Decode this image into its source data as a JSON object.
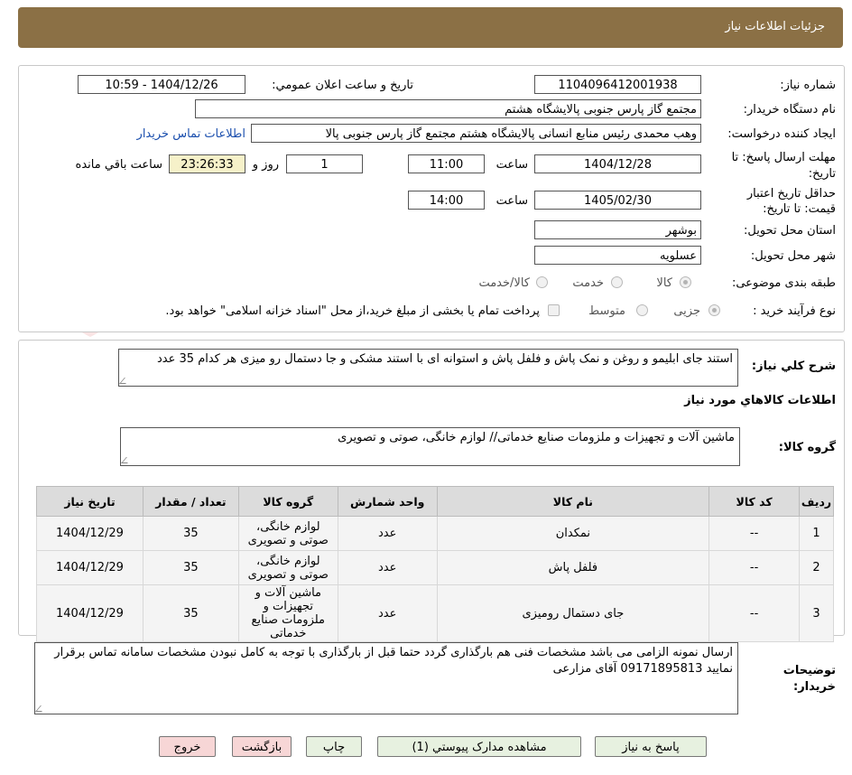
{
  "header": {
    "title": "جزئیات اطلاعات نیاز"
  },
  "form": {
    "need_number_label": "شماره نیاز:",
    "need_number": "1104096412001938",
    "announce_label": "تاریخ و ساعت اعلان عمومي:",
    "announce_value": "1404/12/26 - 10:59",
    "buyer_org_label": "نام دستگاه خریدار:",
    "buyer_org": "مجتمع گاز پارس جنوبی  پالایشگاه هشتم",
    "requester_label": "ایجاد کننده درخواست:",
    "requester": "وهب محمدی رئیس منابع انسانی پالایشگاه هشتم مجتمع گاز پارس جنوبی  پالا",
    "contact_link": "اطلاعات تماس خریدار",
    "deadline_label_1": "مهلت ارسال پاسخ: تا",
    "deadline_label_2": "تاریخ:",
    "deadline_date": "1404/12/28",
    "time_label": "ساعت",
    "deadline_time": "11:00",
    "days_value": "1",
    "days_label": "روز و",
    "remaining_time": "23:26:33",
    "remaining_label": "ساعت باقي مانده",
    "validity_label_1": "حداقل تاريخ اعتبار",
    "validity_label_2": "قيمت: تا تاريخ:",
    "validity_date": "1405/02/30",
    "validity_time": "14:00",
    "province_label": "استان محل تحویل:",
    "province": "بوشهر",
    "city_label": "شهر محل تحویل:",
    "city": "عسلویه",
    "category_label": "طبقه بندی موضوعی:",
    "category_options": [
      "کالا",
      "خدمت",
      "کالا/خدمت"
    ],
    "process_label": "نوع فرآیند خرید :",
    "process_options": [
      "جزیی",
      "متوسط"
    ],
    "payment_note": "پرداخت تمام یا بخشی از مبلغ خرید،از محل \"اسناد خزانه اسلامی\" خواهد بود."
  },
  "general": {
    "desc_label": "شرح کلي نياز:",
    "desc_text": "استند جای ابلیمو و  روغن  و  نمک پاش و فلفل پاش و استوانه ای با استند مشکی و  جا دستمال رو میزی  هر کدام 35 عدد",
    "items_title": "اطلاعات کالاهاي مورد نياز",
    "group_label": "گروه کالا:",
    "group_text": "ماشین آلات و تجهیزات و ملزومات صنایع خدماتی// لوازم خانگی، صوتی و تصویری"
  },
  "table": {
    "headers": [
      "رديف",
      "کد کالا",
      "نام کالا",
      "واحد شمارش",
      "گروه کالا",
      "تعداد / مقدار",
      "تاريخ نياز"
    ],
    "rows": [
      [
        "1",
        "--",
        "نمکدان",
        "عدد",
        "لوازم خانگی، صوتی و تصویری",
        "35",
        "1404/12/29"
      ],
      [
        "2",
        "--",
        "فلفل پاش",
        "عدد",
        "لوازم خانگی، صوتی و تصویری",
        "35",
        "1404/12/29"
      ],
      [
        "3",
        "--",
        "جای دستمال رومیزی",
        "عدد",
        "ماشین آلات و تجهیزات و ملزومات صنایع خدماتی",
        "35",
        "1404/12/29"
      ]
    ]
  },
  "notes": {
    "label_1": "توضيحات",
    "label_2": "خريدار:",
    "text": "ارسال نمونه الزامی می باشد مشخصات فنی هم بارگذاری گردد حتما قبل از بارگذاری با توجه به کامل نبودن مشخصات سامانه تماس برقرار نمایید 09171895813 آقای مزارعی"
  },
  "buttons": {
    "reply": "پاسخ به نياز",
    "attachments": "مشاهده مدارک پيوستي (1)",
    "print": "چاپ",
    "back": "بازگشت",
    "exit": "خروج"
  },
  "watermark": {
    "text": "AriaTender.neT"
  },
  "colors": {
    "header_bg": "#8b7045",
    "link": "#1b4fae",
    "remaining_bg": "#f6f1c9",
    "button_bg": "#e7f1e0",
    "button_red_bg": "#f7d6d6"
  }
}
